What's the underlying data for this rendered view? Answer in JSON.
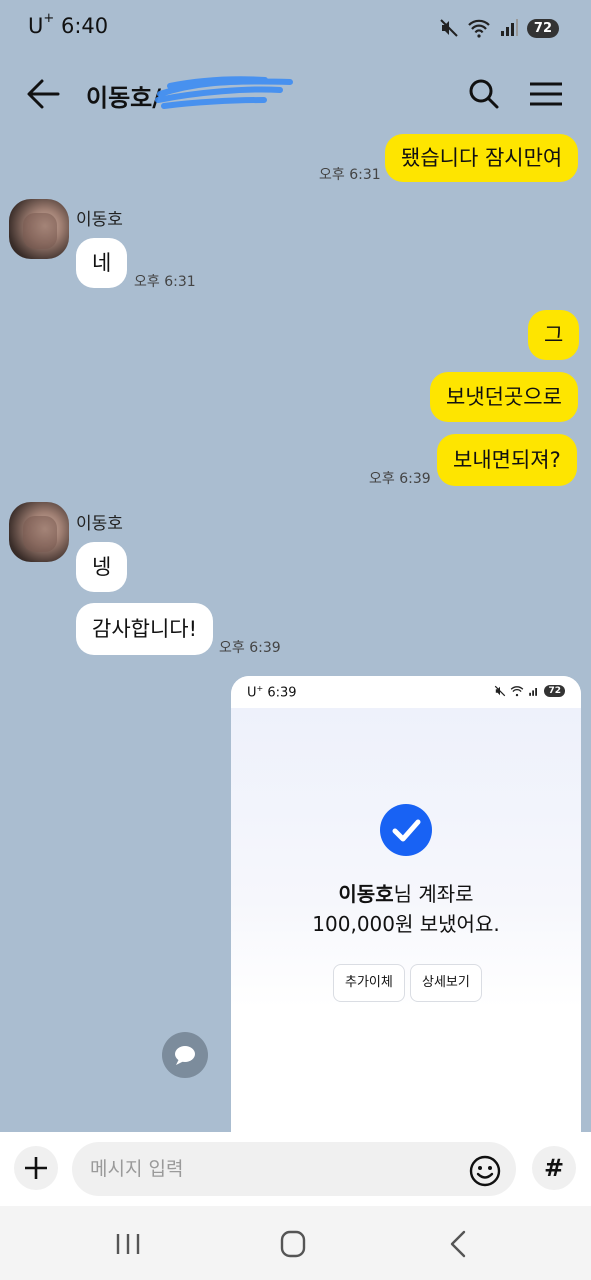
{
  "status_bar": {
    "carrier": "U",
    "carrier_plus": "+",
    "time": "6:40",
    "battery": "72"
  },
  "header": {
    "title": "이동호/"
  },
  "messages": [
    {
      "text": "됐습니다 잠시만여",
      "time": "오후 6:31"
    },
    {
      "sender": "이동호",
      "text": "네",
      "time": "오후 6:31"
    },
    {
      "text": "그"
    },
    {
      "text": "보냇던곳으로"
    },
    {
      "text": "보내면되져?",
      "time": "오후 6:39"
    },
    {
      "sender": "이동호",
      "text": "넹"
    },
    {
      "text": "감사합니다!",
      "time": "오후 6:39"
    }
  ],
  "shared_image": {
    "carrier": "U",
    "carrier_plus": "+",
    "time": "6:39",
    "battery": "72",
    "recipient": "이동호",
    "line1_suffix": "님 계좌로",
    "line2": "100,000원 보냈어요.",
    "button_add": "추가이체",
    "button_detail": "상세보기"
  },
  "input": {
    "placeholder": "메시지 입력",
    "hash_label": "#"
  },
  "colors": {
    "background": "#aabdd0",
    "my_bubble": "#fee500",
    "their_bubble": "#ffffff",
    "check_blue": "#1862f4"
  }
}
